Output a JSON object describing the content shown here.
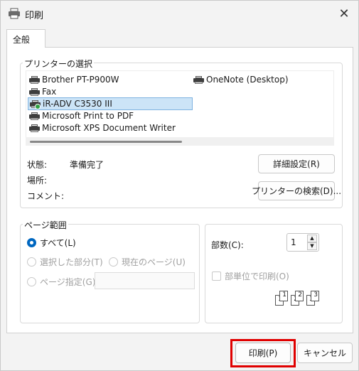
{
  "window": {
    "title": "印刷",
    "close": "✕"
  },
  "tabs": [
    {
      "label": "全般"
    }
  ],
  "printer_group": {
    "title": "プリンターの選択",
    "printers": [
      {
        "name": "Brother PT-P900W"
      },
      {
        "name": "Fax"
      },
      {
        "name": "iR-ADV C3530 III",
        "selected": true
      },
      {
        "name": "Microsoft Print to PDF"
      },
      {
        "name": "Microsoft XPS Document Writer"
      },
      {
        "name": "OneNote (Desktop)"
      }
    ],
    "status_label": "状態:",
    "status_value": "準備完了",
    "location_label": "場所:",
    "comment_label": "コメント:",
    "preferences_button": "詳細設定(R)",
    "find_printer_button": "プリンターの検索(D)..."
  },
  "page_range": {
    "title": "ページ範囲",
    "all": "すべて(L)",
    "selection": "選択した部分(T)",
    "current_page": "現在のページ(U)",
    "pages": "ページ指定(G):",
    "pages_value": ""
  },
  "copies": {
    "label": "部数(C):",
    "value": "1",
    "collate_label": "部単位で印刷(O)",
    "collate_icon_digits": [
      "1",
      "1",
      "2",
      "2",
      "3",
      "3"
    ]
  },
  "buttons": {
    "print": "印刷(P)",
    "cancel": "キャンセル"
  },
  "colors": {
    "accent": "#0067c0",
    "highlight": "#e00000",
    "selected_bg": "#cce4f7"
  }
}
